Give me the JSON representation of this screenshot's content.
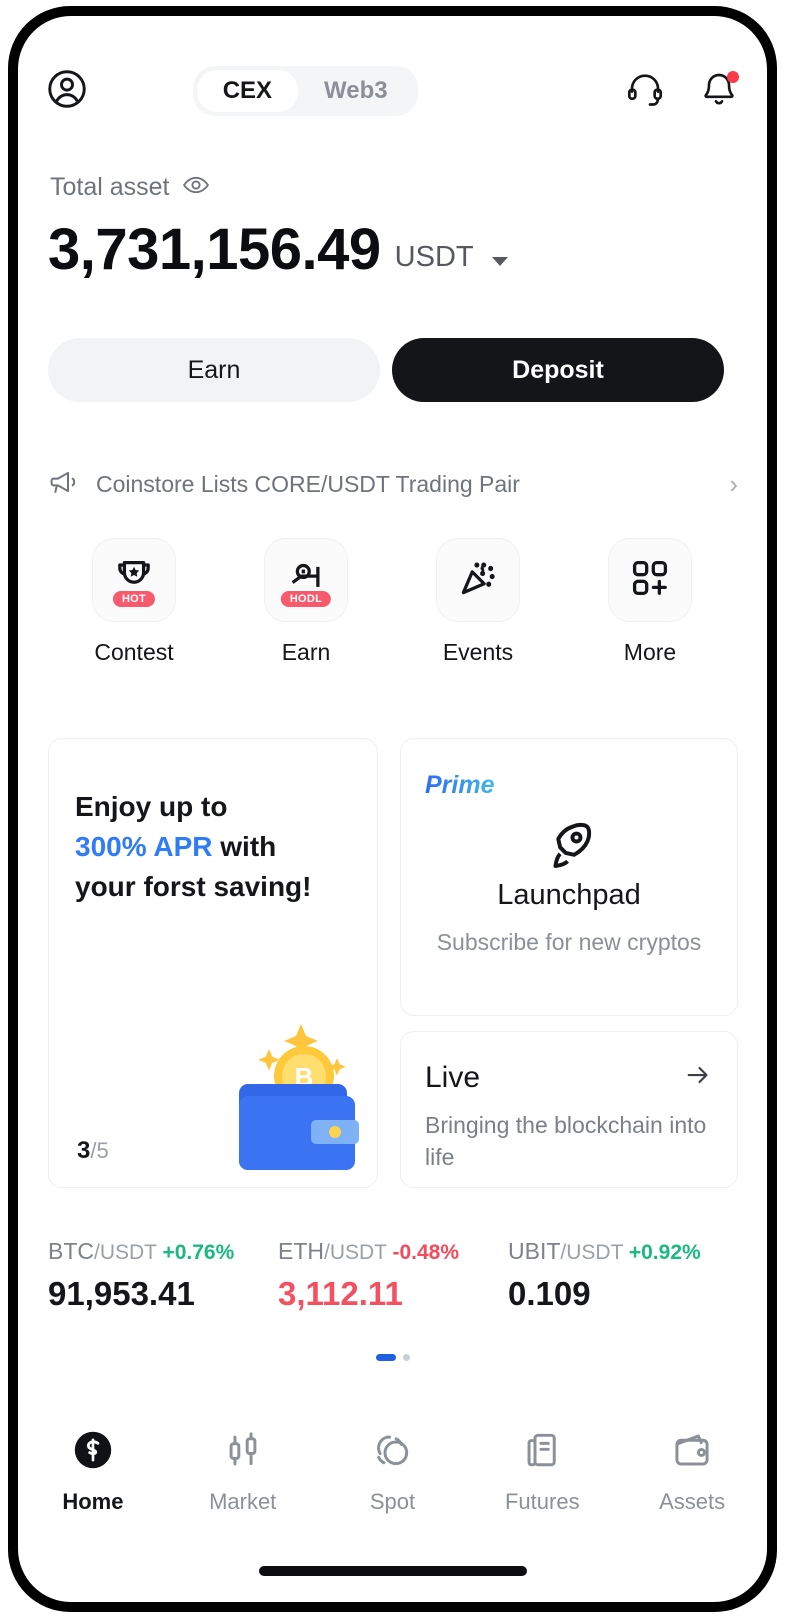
{
  "header": {
    "profile_icon": "user-circle-icon",
    "segments": [
      {
        "label": "CEX",
        "active": true
      },
      {
        "label": "Web3",
        "active": false
      }
    ],
    "support_icon": "headset-icon",
    "notification_icon": "bell-icon",
    "has_notification": true
  },
  "balance": {
    "label": "Total asset",
    "eye_icon": "eye-icon",
    "amount": "3,731,156.49",
    "currency": "USDT"
  },
  "actions": {
    "earn_label": "Earn",
    "deposit_label": "Deposit"
  },
  "announcement": {
    "icon": "megaphone-icon",
    "text": "Coinstore Lists CORE/USDT Trading Pair",
    "chevron": "›"
  },
  "quick_actions": [
    {
      "label": "Contest",
      "icon": "trophy-icon",
      "badge": "HOT"
    },
    {
      "label": "Earn",
      "icon": "piggy-hodl-icon",
      "badge": "HODL"
    },
    {
      "label": "Events",
      "icon": "confetti-icon",
      "badge": ""
    },
    {
      "label": "More",
      "icon": "grid-plus-icon",
      "badge": ""
    }
  ],
  "promo_card": {
    "line1": "Enjoy up to",
    "highlight": "300% APR",
    "line2_tail": " with",
    "line3": "your forst saving!",
    "counter_current": "3",
    "counter_total": "/5",
    "art": "wallet-bitcoin-icon"
  },
  "prime_card": {
    "tag": "Prime",
    "icon": "rocket-icon",
    "title": "Launchpad",
    "subtitle": "Subscribe for new cryptos"
  },
  "live_card": {
    "title": "Live",
    "arrow_icon": "arrow-right-icon",
    "subtitle": "Bringing the blockchain into life"
  },
  "tickers": [
    {
      "base": "BTC",
      "quote": "/USDT",
      "change": "+0.76%",
      "direction": "up",
      "price": "91,953.41",
      "price_color": "black"
    },
    {
      "base": "ETH",
      "quote": "/USDT",
      "change": "-0.48%",
      "direction": "down",
      "price": "3,112.11",
      "price_color": "red"
    },
    {
      "base": "UBIT",
      "quote": "/USDT",
      "change": "+0.92%",
      "direction": "up",
      "price": "0.109",
      "price_color": "black"
    }
  ],
  "pagination": {
    "active_index": 0,
    "count": 2
  },
  "bottom_nav": [
    {
      "label": "Home",
      "icon": "coinstore-logo-icon",
      "active": true
    },
    {
      "label": "Market",
      "icon": "candlestick-icon",
      "active": false
    },
    {
      "label": "Spot",
      "icon": "spot-circles-icon",
      "active": false
    },
    {
      "label": "Futures",
      "icon": "document-icon",
      "active": false
    },
    {
      "label": "Assets",
      "icon": "wallet-icon",
      "active": false
    }
  ],
  "colors": {
    "accent_blue": "#2f7cf6",
    "up_green": "#19b97f",
    "down_red": "#f4505f",
    "badge_red": "#f8596b",
    "dark": "#15161a"
  }
}
